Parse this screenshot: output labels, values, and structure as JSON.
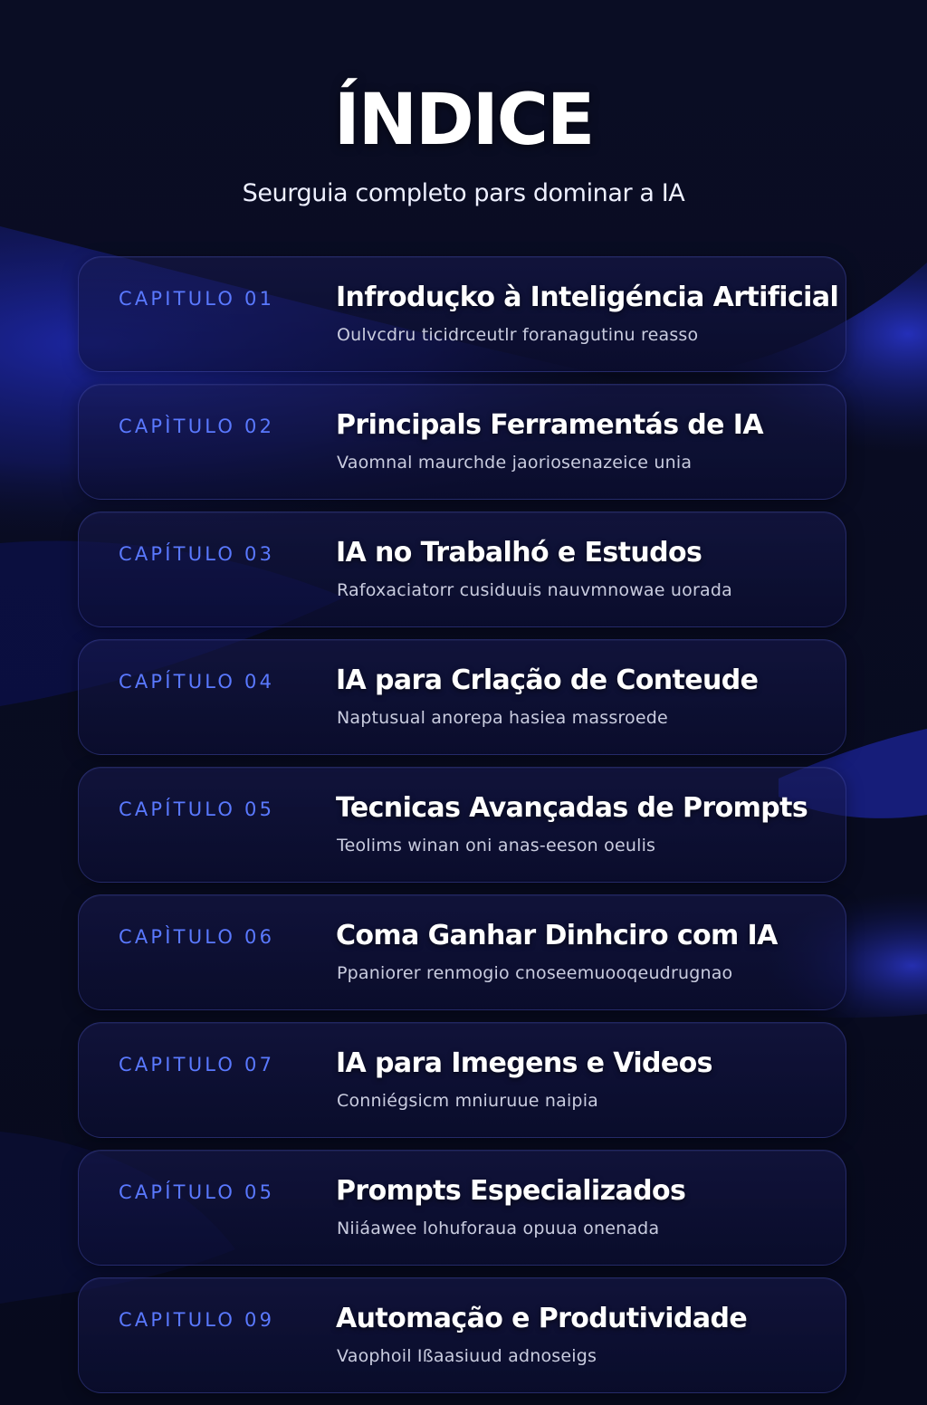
{
  "header": {
    "title": "ÍNDICE",
    "subtitle": "Seurguia completo pars dominar a IA"
  },
  "chapters": [
    {
      "label": "CAPITULO 01",
      "title": "Infroduçko à Inteligéncia Artificial",
      "desc": "Oulvcdru  ticidrceutlr foranagutinu reasso"
    },
    {
      "label": "CAPÌTULO 02",
      "title": "Principals Ferramentás de IA",
      "desc": "Vaomnal  maurchde jaoriosenazeice unia"
    },
    {
      "label": "CAPÍTULO 03",
      "title": "IA no Trabalhó e Estudos",
      "desc": "Rafoxaciatorr cusiduuis nauvmnowae uorada"
    },
    {
      "label": "CAPÍTULO 04",
      "title": "IA para Crlação de Conteude",
      "desc": "Naptusual anorepa hasiea massroede"
    },
    {
      "label": "CAPÍTULO 05",
      "title": "Tecnicas Avançadas de Prompts",
      "desc": "Teolims winan oni anas-eeson oeulis"
    },
    {
      "label": "CAPÌTULO 06",
      "title": "Coma Ganhar Dinhciro com IA",
      "desc": "Ppaniorer renmogio cnoseemuooqeudrugnao"
    },
    {
      "label": "CAPITULO 07",
      "title": "IA para Imegens e Videos",
      "desc": "Conniégsicm mniuruue  naipia"
    },
    {
      "label": "CAPÍTULO 05",
      "title": "Prompts Especializados",
      "desc": "Niiáawee lohuforaua opuua  onenada"
    },
    {
      "label": "CAPITULO 09",
      "title": "Automação e Produtividade",
      "desc": "Vaophoil Ißaasiuud adnoseigs"
    }
  ],
  "colors": {
    "background": "#070a1d",
    "accent": "#5a79ff",
    "card_border": "#3a3fa0",
    "title_text": "#ffffff",
    "desc_text": "#c9ccdf"
  }
}
